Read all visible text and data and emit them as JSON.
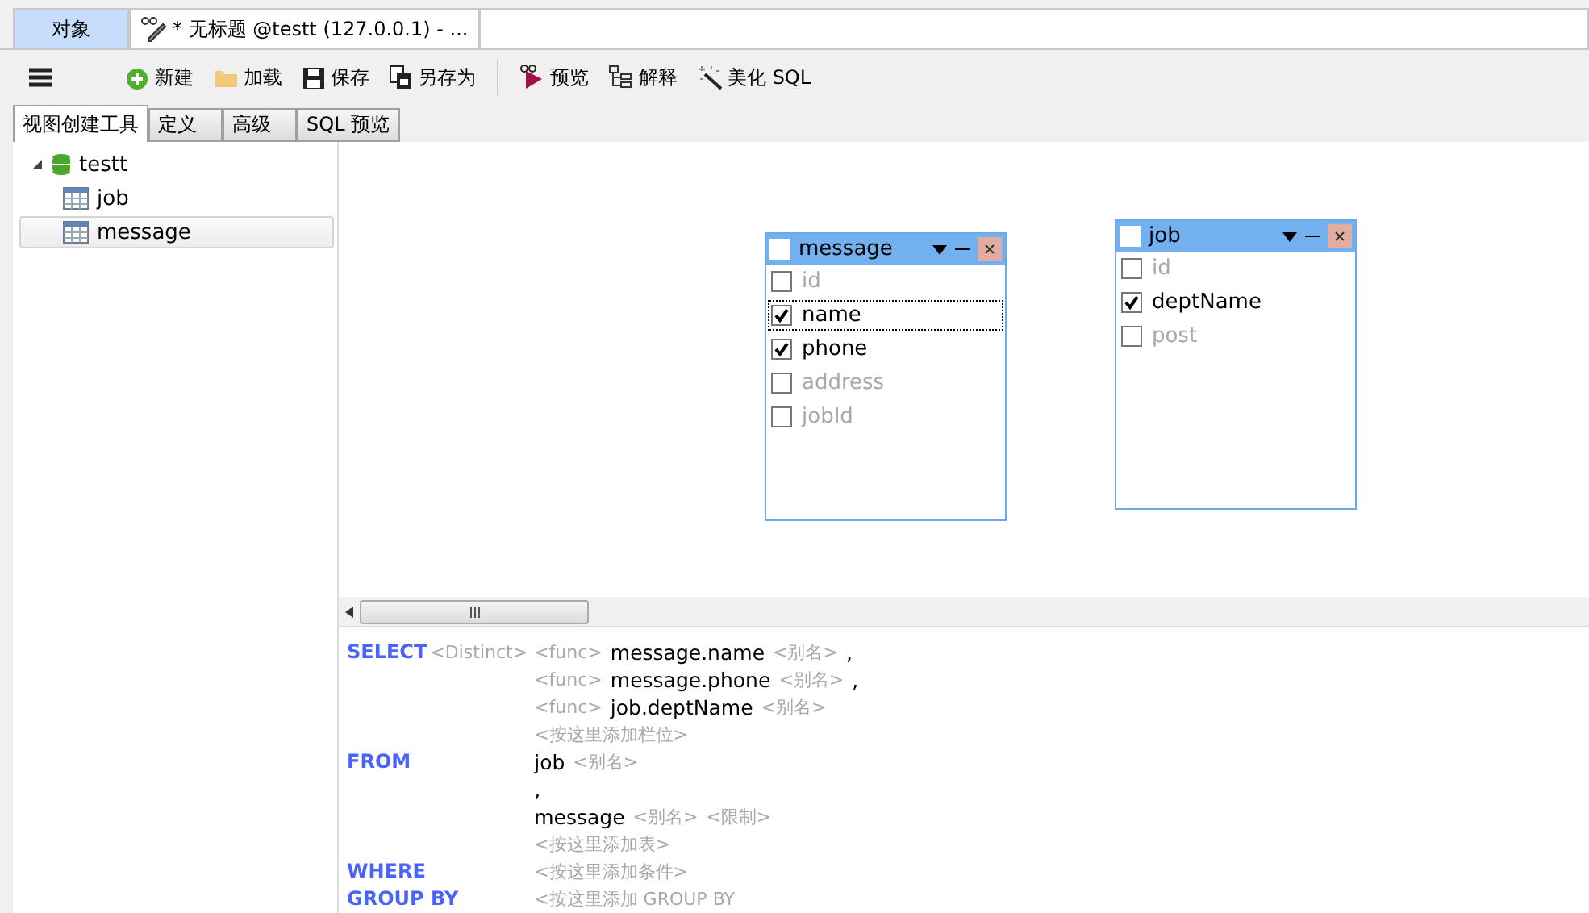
{
  "doc_tabs": [
    {
      "label": "对象",
      "selected": true,
      "kind": "plain"
    },
    {
      "label": "* 无标题 @testt (127.0.0.1) - ...",
      "selected": false,
      "kind": "query"
    }
  ],
  "toolbar": [
    {
      "label": "新建",
      "kind": "new"
    },
    {
      "label": "加载",
      "kind": "load"
    },
    {
      "label": "保存",
      "kind": "save"
    },
    {
      "label": "另存为",
      "kind": "saveas"
    },
    {
      "label": "预览",
      "kind": "preview"
    },
    {
      "label": "解释",
      "kind": "explain"
    },
    {
      "label": "美化 SQL",
      "kind": "beautify"
    }
  ],
  "sub_tabs": [
    {
      "label": "视图创建工具",
      "selected": true
    },
    {
      "label": "定义",
      "selected": false
    },
    {
      "label": "高级",
      "selected": false
    },
    {
      "label": "SQL 预览",
      "selected": false
    }
  ],
  "tree": [
    {
      "label": "testt",
      "kind": "database",
      "expanded": true,
      "selected": false,
      "children": [
        {
          "label": "job",
          "kind": "table",
          "selected": false
        },
        {
          "label": "message",
          "kind": "table",
          "selected": true
        }
      ]
    }
  ],
  "canvas_tables": [
    {
      "title": "message",
      "all_checked": false,
      "fields": [
        {
          "name": "id",
          "checked": false,
          "focused": false
        },
        {
          "name": "name",
          "checked": true,
          "focused": true
        },
        {
          "name": "phone",
          "checked": true,
          "focused": false
        },
        {
          "name": "address",
          "checked": false,
          "focused": false
        },
        {
          "name": "jobId",
          "checked": false,
          "focused": false
        }
      ]
    },
    {
      "title": "job",
      "all_checked": false,
      "fields": [
        {
          "name": "id",
          "checked": false,
          "focused": false
        },
        {
          "name": "deptName",
          "checked": true,
          "focused": false
        },
        {
          "name": "post",
          "checked": false,
          "focused": false
        }
      ]
    }
  ],
  "sql": [
    {
      "keyword": "SELECT",
      "modifier": "<Distinct>",
      "parts": [
        {
          "text": "<func>",
          "kind": "hint"
        },
        {
          "text": "message.name",
          "kind": "name"
        },
        {
          "text": "<别名>",
          "kind": "hint"
        },
        {
          "text": ",",
          "kind": "name"
        }
      ]
    },
    {
      "parts": [
        {
          "text": "<func>",
          "kind": "hint"
        },
        {
          "text": "message.phone",
          "kind": "name"
        },
        {
          "text": "<别名>",
          "kind": "hint"
        },
        {
          "text": ",",
          "kind": "name"
        }
      ]
    },
    {
      "parts": [
        {
          "text": "<func>",
          "kind": "hint"
        },
        {
          "text": "job.deptName",
          "kind": "name"
        },
        {
          "text": "<别名>",
          "kind": "hint"
        }
      ]
    },
    {
      "parts": [
        {
          "text": "<按这里添加栏位>",
          "kind": "hint"
        }
      ]
    },
    {
      "keyword": "FROM",
      "parts": [
        {
          "text": "job",
          "kind": "name"
        },
        {
          "text": "<别名>",
          "kind": "hint"
        }
      ]
    },
    {
      "parts": [
        {
          "text": ",",
          "kind": "name"
        }
      ]
    },
    {
      "parts": [
        {
          "text": "message",
          "kind": "name"
        },
        {
          "text": "<别名>",
          "kind": "hint"
        },
        {
          "text": "<限制>",
          "kind": "hint"
        }
      ]
    },
    {
      "parts": [
        {
          "text": "<按这里添加表>",
          "kind": "hint"
        }
      ]
    },
    {
      "keyword": "WHERE",
      "parts": [
        {
          "text": "<按这里添加条件>",
          "kind": "hint"
        }
      ]
    },
    {
      "keyword": "GROUP BY",
      "parts": [
        {
          "text": "<按这里添加 GROUP BY",
          "kind": "hint"
        }
      ]
    }
  ]
}
